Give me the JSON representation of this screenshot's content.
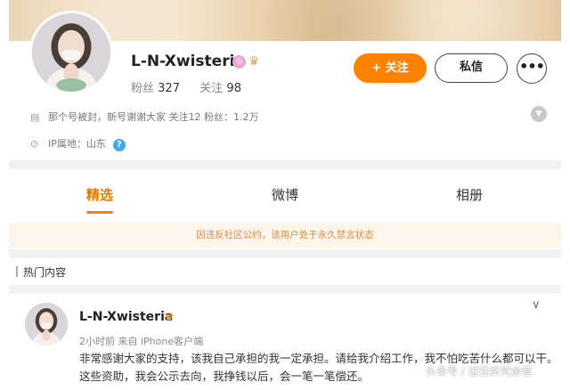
{
  "profile": {
    "username": "L-N-Xwisteria",
    "badges": [
      "vip-badge-icon",
      "crown-icon"
    ],
    "fans_label": "粉丝",
    "fans_count": "327",
    "following_label": "关注",
    "following_count": "98",
    "follow_button": "+ 关注",
    "message_button": "私信",
    "more_button": "•••",
    "bio": "那个号被封，新号谢谢大家 关注12 粉丝：1.2万",
    "ip_location": "IP属地：山东",
    "help_icon": "?"
  },
  "tabs": [
    {
      "label": "精选",
      "active": true
    },
    {
      "label": "微博",
      "active": false
    },
    {
      "label": "相册",
      "active": false
    }
  ],
  "notice": "因违反社区公约，该用户处于永久禁言状态",
  "section_title": "热门内容",
  "post": {
    "username": "L-N-Xwisteria",
    "meta": "2小时前 来自 iPhone客户端",
    "text": "非常感谢大家的支持，该我自己承担的我一定承担。请给我介绍工作，我不怕吃苦什么都可以干。这些资助，我会公示去向，我挣钱以后，会一笔一笔偿还。"
  },
  "watermark": "头条号 / 过往终究余音",
  "colors": {
    "accent": "#ff8200",
    "tab_active": "#e07a00",
    "notice_bg": "#fdf6ec",
    "notice_text": "#e4893b",
    "help_icon": "#3fa9f5"
  }
}
